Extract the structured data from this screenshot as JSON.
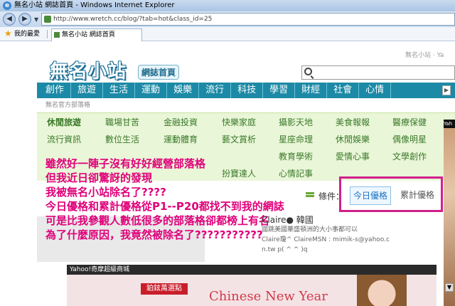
{
  "window": {
    "title": "無名小站 網誌首頁 - Windows Internet Explorer",
    "address": "http://www.wretch.cc/blog/?tab=hot&class_id=25",
    "favorites_label": "我的最愛",
    "tab_title": "無名小站 網誌首頁"
  },
  "header": {
    "logo_text": "無名小站",
    "logo_sub": "網誌首頁",
    "top_right": "無名小站 · Ya"
  },
  "categories": [
    "創作",
    "旅遊",
    "生活",
    "運動",
    "娛樂",
    "流行",
    "科技",
    "學習",
    "財經",
    "社會",
    "心情"
  ],
  "breadcrumb": "無名官方部落格",
  "subcategories": {
    "row1": [
      "休閒旅遊",
      "職場甘苦",
      "金融投資",
      "快樂家庭",
      "攝影天地",
      "美食報報",
      "醫療保健"
    ],
    "row2": [
      "流行資訊",
      "數位生活",
      "運動體育",
      "藝文賞析",
      "星座命理",
      "休閒娛樂",
      "偶像明星"
    ],
    "row3": [
      "",
      "",
      "",
      "",
      "教育學術",
      "愛情心事",
      "文學創作"
    ],
    "row4": [
      "",
      "",
      "",
      "扮寶達人",
      "心情記事",
      "",
      ""
    ]
  },
  "overlay_lines": [
    "雖然好一陣子沒有好好經營部落格",
    "但我近日卻驚訝的發現",
    "我被無名小站除名了????",
    "今日優格和累計優格從P1--P20都找不到我的網誌",
    "可是比我參觀人數低很多的部落格卻都榜上有名",
    "為了什麼原因，我竟然被除名了???????????"
  ],
  "filter": {
    "label": "條件：",
    "tab_today": "今日優格",
    "tab_total": "累計優格"
  },
  "blog_entry": {
    "name": "Claire● 韓國",
    "line1": "國跳美國華盛頓洲的大小事都可以",
    "line2": "Claire瓊^ ClaireMSN : mimik-s@yahoo.c",
    "line3": "n.tw p( ^ ^ )q"
  },
  "ad": {
    "top_label": "Yahoo!奇摩超級商城",
    "button": "鉑鉉萬選點",
    "title": "Chinese New Year"
  },
  "right_strip_label": "Yah"
}
